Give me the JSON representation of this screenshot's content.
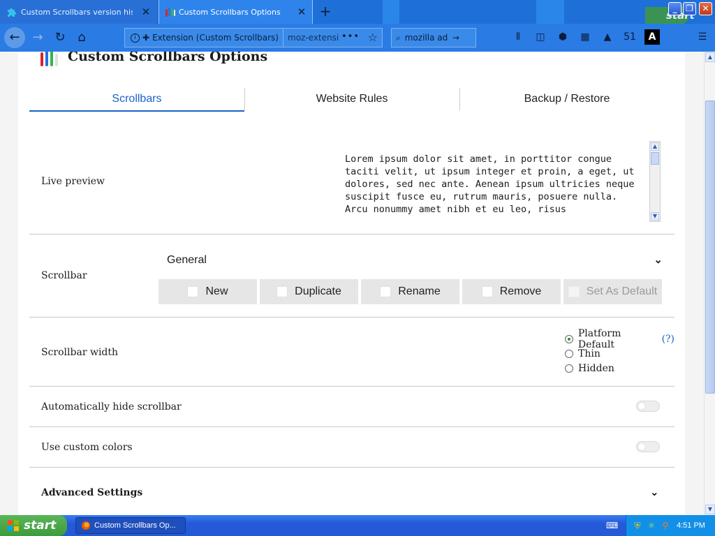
{
  "browser": {
    "tabs": [
      {
        "title": "Custom Scrollbars version history",
        "icon": "puzzle-icon"
      },
      {
        "title": "Custom Scrollbars Options",
        "icon": "scrollbars-logo-icon"
      }
    ],
    "urlbar": {
      "identity": "Extension (Custom Scrollbars)",
      "url": "moz-extension://",
      "page_actions": "•••"
    },
    "searchbar": {
      "value": "mozilla addons"
    },
    "toolbar_badge": "51"
  },
  "page": {
    "title": "Custom Scrollbars Options",
    "tabs": [
      "Scrollbars",
      "Website Rules",
      "Backup / Restore"
    ],
    "active_tab": "Scrollbars",
    "preview": {
      "label": "Live preview",
      "text": "Lorem ipsum dolor sit amet, in porttitor congue taciti velit, ut ipsum integer et proin, a eget, ut dolores, sed nec ante. Aenean ipsum ultricies neque suscipit fusce eu, rutrum mauris, posuere nulla. Arcu nonummy amet nibh et eu leo, risus"
    },
    "scrollbar": {
      "label": "Scrollbar",
      "selected": "General",
      "buttons": {
        "new": "New",
        "duplicate": "Duplicate",
        "rename": "Rename",
        "remove": "Remove",
        "set_default": "Set As Default"
      }
    },
    "width": {
      "label": "Scrollbar width",
      "options": [
        "Platform Default",
        "Thin",
        "Hidden"
      ],
      "selected": "Platform Default",
      "help": "(?)"
    },
    "autohide": {
      "label": "Automatically hide scrollbar",
      "enabled": false
    },
    "colors": {
      "label": "Use custom colors",
      "enabled": false
    },
    "advanced": {
      "label": "Advanced Settings"
    }
  },
  "taskbar": {
    "start_label": "start",
    "task": "Custom Scrollbars Op...",
    "clock": "4:51 PM"
  },
  "colors": {
    "accent": "#1a62c9",
    "titlebar": "#1f6fd8",
    "start_green": "#3c9b3a"
  }
}
